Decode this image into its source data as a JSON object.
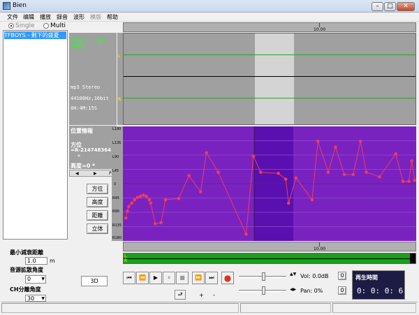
{
  "window": {
    "title": "Bien",
    "controls": {
      "minimize": "–",
      "maximize": "□",
      "close": "✕"
    }
  },
  "menu": [
    {
      "label": "文件",
      "enabled": true
    },
    {
      "label": "编辑",
      "enabled": true
    },
    {
      "label": "播放",
      "enabled": true
    },
    {
      "label": "録音",
      "enabled": true
    },
    {
      "label": "波形",
      "enabled": true
    },
    {
      "label": "模版",
      "enabled": false
    },
    {
      "label": "帮助",
      "enabled": true
    }
  ],
  "mode": {
    "single": "Single",
    "multi": "Multi",
    "selected": "single"
  },
  "tracklist": {
    "selected": "TFBOYS - 剩下的盛夏"
  },
  "file_info": {
    "name_line1": "TFBOYS - 剩下",
    "name_line2": "的盛夏",
    "format": "mp3 Stereo",
    "rate": "44100Hz,16bit",
    "duration": "0H:4M:15S"
  },
  "position_info": {
    "title": "位置情報",
    "azimuth_label": "方位",
    "azimuth_value": "=R-214748364",
    "azimuth_cont": "*",
    "height_line": "高度=0 *",
    "scroll_p": "P"
  },
  "buttons": {
    "azimuth": "方位",
    "height": "高度",
    "distance": "距離",
    "body": "立体",
    "mode_3d": "3D"
  },
  "params": {
    "min_decay_label": "最小減衰距離",
    "min_decay_value": "1.0",
    "min_decay_unit": "m",
    "spread_label": "音源拡散角度",
    "spread_value": "0",
    "ch_sep_label": "CH分離角度",
    "ch_sep_value": "30"
  },
  "waveform": {
    "time_mark": "10.00",
    "channel_l": "L",
    "channel_r": "R"
  },
  "automation_axis": {
    "ticks": [
      "L180",
      "L135",
      "L90",
      "L45",
      "0",
      "R45",
      "R90",
      "R135",
      "R180"
    ]
  },
  "lower_axis": {
    "time_mark": "10.00",
    "l": "L",
    "r": "R"
  },
  "transport": {
    "first": "⏮",
    "prev": "⏪",
    "play": "▶",
    "pause": "⏸",
    "stop": "■",
    "next": "⏩",
    "last": "⏭",
    "record": "●",
    "loop": "⮐",
    "plus": "+",
    "minus": "-"
  },
  "mixer": {
    "vol_label": "Vol: 0.0dB",
    "vol_reset": "0",
    "pan_label": "Pan: 0%",
    "pan_reset": "0"
  },
  "playback_time": {
    "title": "再生時間",
    "value": "0: 0: 0:  6"
  },
  "colors": {
    "automation_bg": "#7a22c0",
    "selection": "#5a0fb0",
    "curve": "#f03c5a",
    "track_select": "#3399ff",
    "meter": "#18a018"
  },
  "automation_points": [
    [
      0.01,
      0.8
    ],
    [
      0.015,
      0.74
    ],
    [
      0.02,
      0.7
    ],
    [
      0.03,
      0.67
    ],
    [
      0.04,
      0.64
    ],
    [
      0.05,
      0.62
    ],
    [
      0.06,
      0.61
    ],
    [
      0.07,
      0.6
    ],
    [
      0.08,
      0.61
    ],
    [
      0.09,
      0.64
    ],
    [
      0.095,
      0.67
    ],
    [
      0.11,
      0.85
    ],
    [
      0.13,
      0.84
    ],
    [
      0.145,
      0.64
    ],
    [
      0.19,
      0.63
    ],
    [
      0.225,
      0.43
    ],
    [
      0.265,
      0.57
    ],
    [
      0.285,
      0.23
    ],
    [
      0.325,
      0.4
    ],
    [
      0.42,
      0.94
    ],
    [
      0.445,
      0.26
    ],
    [
      0.47,
      0.4
    ],
    [
      0.53,
      0.41
    ],
    [
      0.555,
      0.46
    ],
    [
      0.565,
      0.67
    ],
    [
      0.59,
      0.45
    ],
    [
      0.645,
      0.64
    ],
    [
      0.665,
      0.13
    ],
    [
      0.7,
      0.4
    ],
    [
      0.725,
      0.18
    ],
    [
      0.755,
      0.42
    ],
    [
      0.785,
      0.42
    ],
    [
      0.81,
      0.13
    ],
    [
      0.83,
      0.4
    ],
    [
      0.875,
      0.44
    ],
    [
      0.93,
      0.24
    ],
    [
      0.955,
      0.48
    ],
    [
      0.975,
      0.48
    ],
    [
      0.985,
      0.3
    ],
    [
      0.995,
      0.47
    ]
  ]
}
